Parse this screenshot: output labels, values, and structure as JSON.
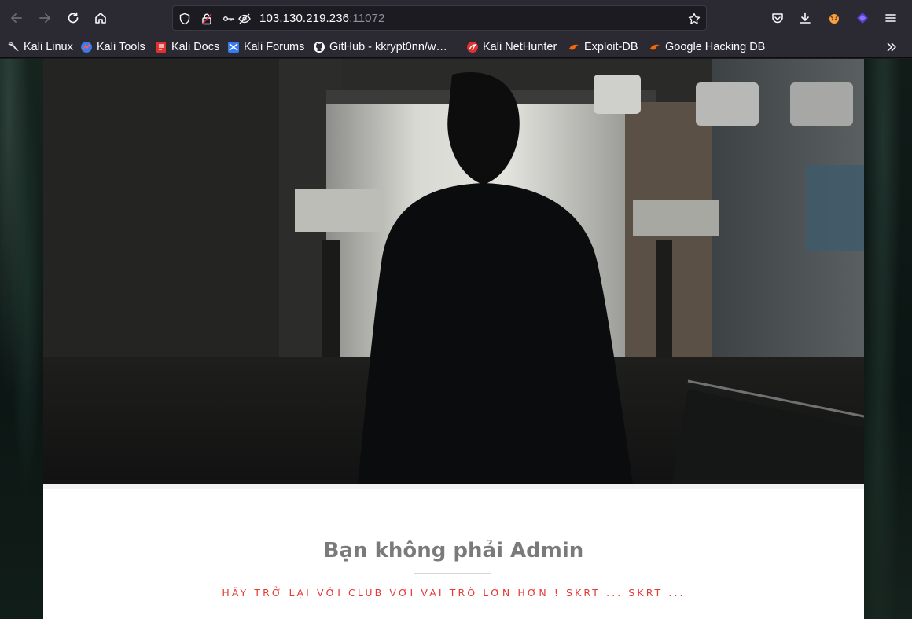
{
  "browser": {
    "url_host": "103.130.219.236",
    "url_port": ":11072",
    "icons": {
      "back": "arrow-left-icon",
      "forward": "arrow-right-icon",
      "reload": "reload-icon",
      "home": "home-icon",
      "shield": "shield-icon",
      "lock": "lock-icon",
      "permissions": "permissions-icon",
      "tracking": "tracking-protection-icon",
      "bookmark_star": "star-icon",
      "pocket": "pocket-icon",
      "downloads": "download-icon",
      "extension1": "extension-icon",
      "extension2": "extension-icon",
      "menu": "hamburger-menu-icon"
    }
  },
  "bookmarks": [
    {
      "label": "Kali Linux",
      "icon": "kali-dragon-icon"
    },
    {
      "label": "Kali Tools",
      "icon": "kali-tools-icon"
    },
    {
      "label": "Kali Docs",
      "icon": "kali-docs-icon"
    },
    {
      "label": "Kali Forums",
      "icon": "kali-forums-icon"
    },
    {
      "label": "GitHub - kkrypt0nn/w…",
      "icon": "github-icon"
    },
    {
      "label": "Kali NetHunter",
      "icon": "nethunter-icon"
    },
    {
      "label": "Exploit-DB",
      "icon": "exploit-db-icon"
    },
    {
      "label": "Google Hacking DB",
      "icon": "ghdb-icon"
    }
  ],
  "page": {
    "title": "Bạn không phải Admin",
    "subtitle": "HÃY TRỞ LẠI VỚI CLUB VỚI VAI TRÒ LỚN HƠN ! SKRT ... SKRT ..."
  },
  "colors": {
    "toolbar": "#2b2a33",
    "title": "#7a7a7a",
    "subtitle": "#e53935"
  }
}
